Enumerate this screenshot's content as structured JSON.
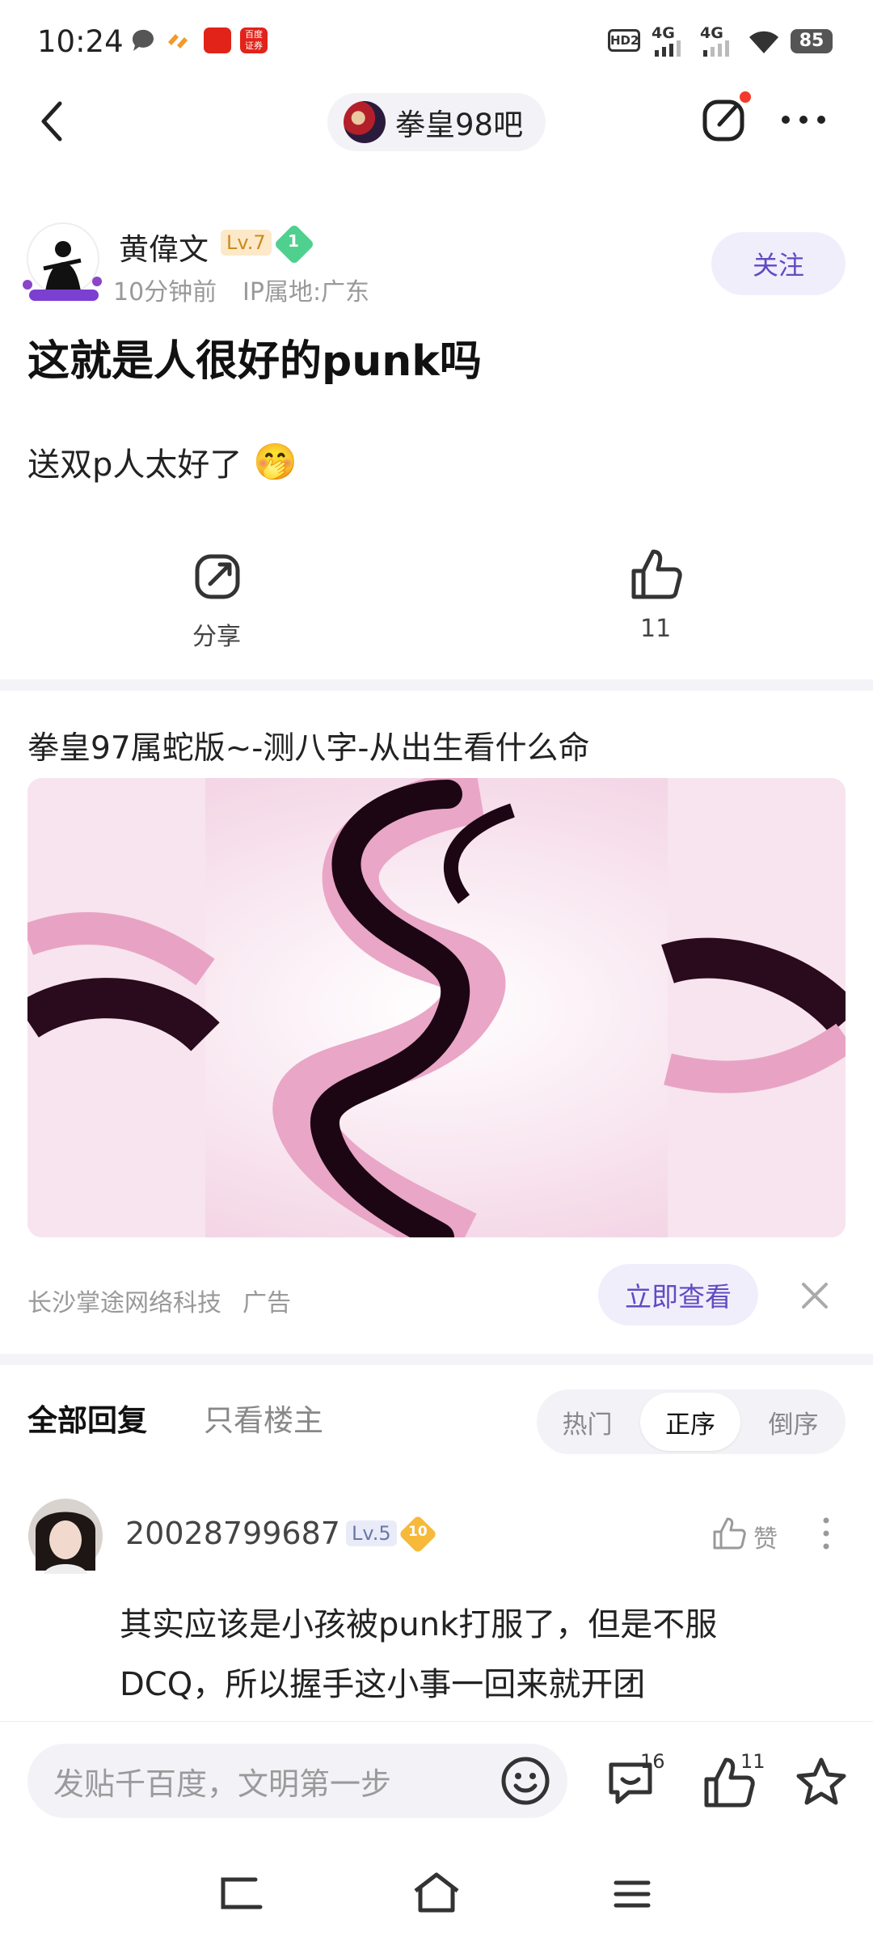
{
  "status_bar": {
    "time": "10:24",
    "battery": "85",
    "network_1": "4G",
    "network_2": "4G",
    "hd": "HD2",
    "app_badge": "百度 证券"
  },
  "nav": {
    "forum_name": "拳皇98吧"
  },
  "post": {
    "author": "黄偉文",
    "level": "Lv.7",
    "badge_number": "1",
    "time": "10分钟前",
    "ip_location": "IP属地:广东",
    "follow_label": "关注",
    "title": "这就是人很好的punk吗",
    "body": "送双p人太好了",
    "emoji": "🤭",
    "share_label": "分享",
    "like_count": "11"
  },
  "ad": {
    "title": "拳皇97属蛇版~-测八字-从出生看什么命",
    "advertiser": "长沙掌途网络科技",
    "ad_label": "广告",
    "cta": "立即查看"
  },
  "replies": {
    "tab_all": "全部回复",
    "tab_owner": "只看楼主",
    "sort_hot": "热门",
    "sort_asc": "正序",
    "sort_desc": "倒序",
    "items": [
      {
        "user": "20028799687",
        "level": "Lv.5",
        "badge_number": "10",
        "like_label": "赞",
        "text_line1": "其实应该是小孩被punk打服了，但是不服",
        "text_line2": "DCQ，所以握手这小事一回来就开团"
      }
    ]
  },
  "bottom": {
    "input_placeholder": "发贴千百度，文明第一步",
    "comment_count": "16",
    "like_count": "11"
  },
  "colors": {
    "accent": "#614bc3",
    "follow_bg": "#f1eefc",
    "level_bg": "#fde9c9",
    "level_text": "#c98a1e",
    "separator": "#f4f4f8"
  }
}
